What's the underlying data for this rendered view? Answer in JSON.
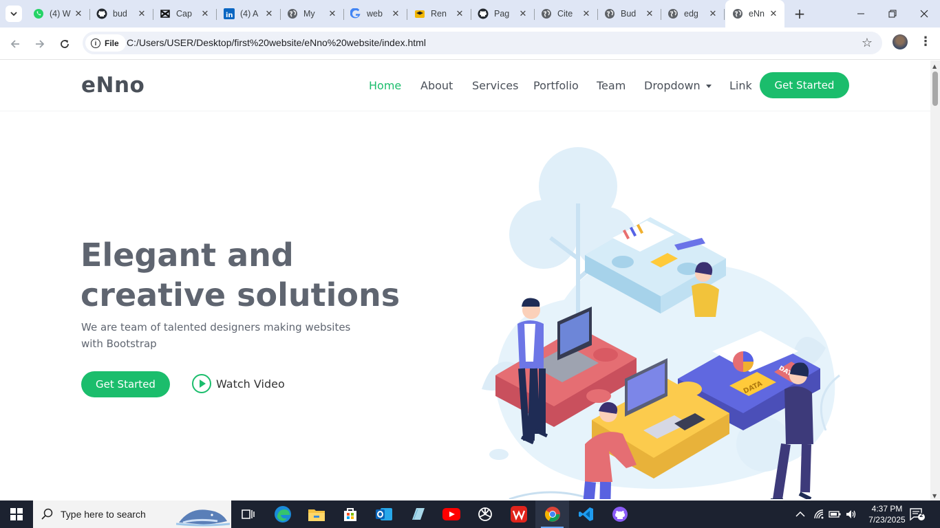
{
  "browser": {
    "tabs": [
      {
        "title": "(4) W",
        "icon": "whatsapp-icon"
      },
      {
        "title": "bud",
        "icon": "github-icon"
      },
      {
        "title": "Cap",
        "icon": "capcut-icon"
      },
      {
        "title": "(4) A",
        "icon": "linkedin-icon"
      },
      {
        "title": "My",
        "icon": "globe-icon"
      },
      {
        "title": "web",
        "icon": "google-icon"
      },
      {
        "title": "Ren",
        "icon": "course-icon"
      },
      {
        "title": "Pag",
        "icon": "github-icon"
      },
      {
        "title": "Cite",
        "icon": "globe-icon"
      },
      {
        "title": "Bud",
        "icon": "globe-icon"
      },
      {
        "title": "edg",
        "icon": "globe-icon"
      },
      {
        "title": "eNn",
        "icon": "globe-icon"
      }
    ],
    "active_tab_index": 11,
    "address": {
      "chip": "File",
      "url": "C:/Users/USER/Desktop/first%20website/eNno%20website/index.html"
    }
  },
  "site": {
    "logo": "eNno",
    "nav": {
      "home": "Home",
      "about": "About",
      "services": "Services",
      "portfolio": "Portfolio",
      "team": "Team",
      "dropdown": "Dropdown",
      "link": "Link"
    },
    "cta": "Get Started",
    "hero": {
      "title": "Elegant and creative solutions",
      "subtitle": "We are team of talented designers making websites with Bootstrap",
      "primary_button": "Get Started",
      "watch_video": "Watch Video"
    },
    "illustration_text": {
      "data_label": "DATA",
      "data_label_2": "DATA"
    },
    "colors": {
      "accent": "#1bbd6c",
      "text": "#5f6570"
    }
  },
  "taskbar": {
    "search_placeholder": "Type here to search",
    "time": "4:37 PM",
    "date": "7/23/2025",
    "notification_count": "2"
  }
}
